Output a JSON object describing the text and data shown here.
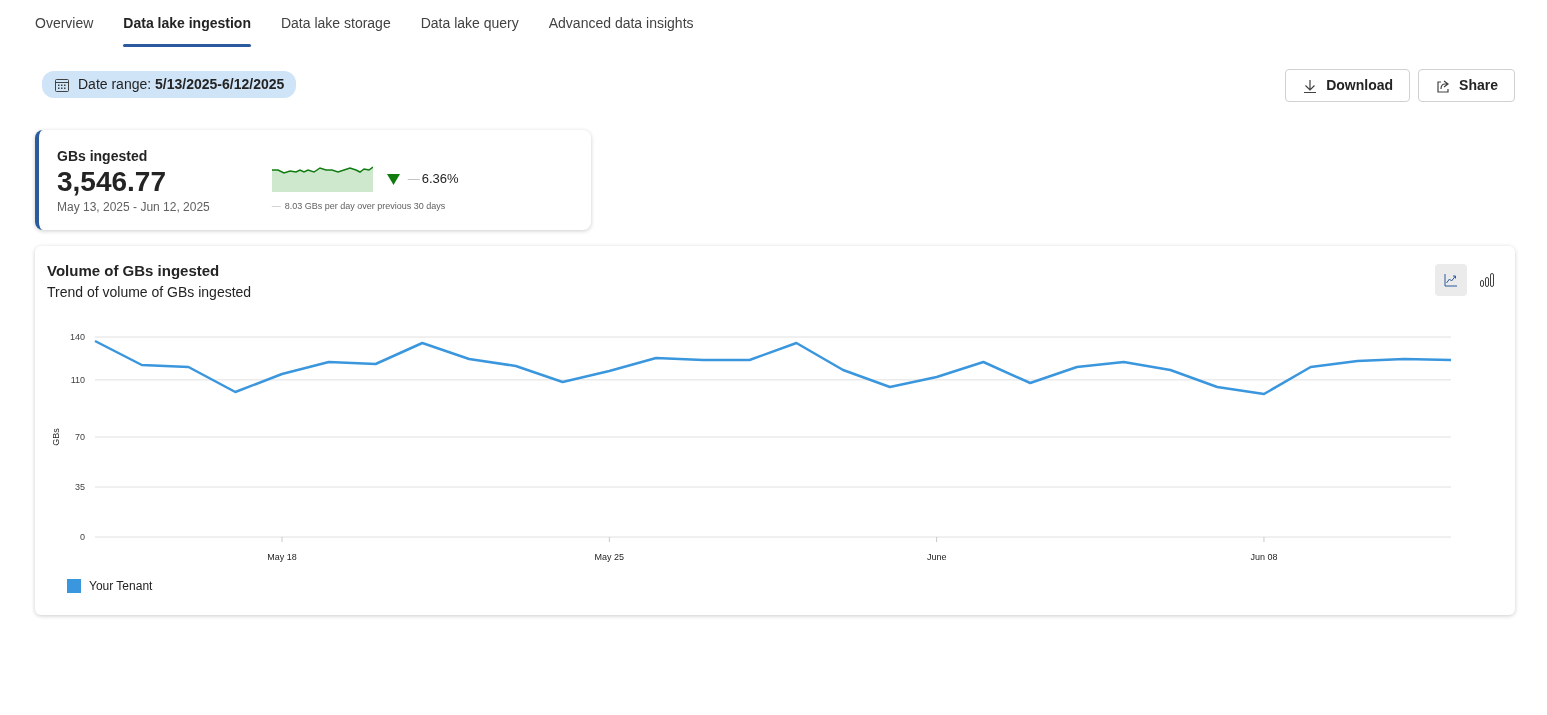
{
  "tabs": [
    {
      "label": "Overview",
      "selected": false
    },
    {
      "label": "Data lake ingestion",
      "selected": true
    },
    {
      "label": "Data lake storage",
      "selected": false
    },
    {
      "label": "Data lake query",
      "selected": false
    },
    {
      "label": "Advanced data insights",
      "selected": false
    }
  ],
  "date_range": {
    "label": "Date range:",
    "value": "5/13/2025-6/12/2025"
  },
  "actions": [
    {
      "kind": "download",
      "label": "Download"
    },
    {
      "kind": "share",
      "label": "Share"
    }
  ],
  "kpi": {
    "title": "GBs ingested",
    "value": "3,546.77",
    "period": "May 13, 2025 - Jun 12, 2025",
    "change_down": true,
    "change_prefix": "—",
    "change": "6.36%",
    "baseline_prefix": "—",
    "baseline": "8.03 GBs per day over previous 30 days"
  },
  "volume_chart": {
    "title": "Volume of GBs ingested",
    "subtitle": "Trend of volume of GBs ingested",
    "view_toggles": [
      {
        "kind": "line",
        "selected": true
      },
      {
        "kind": "bar",
        "selected": false
      }
    ],
    "chart_data": {
      "type": "line",
      "ylabel": "GBs",
      "ylim": [
        0,
        140
      ],
      "grid": true,
      "yticks": [
        0,
        35,
        70,
        110,
        140
      ],
      "categories": [
        null,
        null,
        null,
        null,
        "May 18",
        null,
        null,
        null,
        null,
        null,
        null,
        "May 25",
        null,
        null,
        null,
        null,
        null,
        null,
        "June",
        null,
        null,
        null,
        null,
        null,
        null,
        "Jun 08",
        null,
        null,
        null,
        null
      ],
      "series": [
        {
          "name": "Your Tenant",
          "color": "#3a96dd",
          "values": [
            137.2,
            120.4,
            119,
            101.5,
            114.1,
            122.5,
            121.1,
            135.8,
            124.6,
            119.7,
            108.5,
            116.2,
            125.3,
            123.9,
            123.9,
            135.8,
            116.9,
            105,
            112,
            122.5,
            107.8,
            119,
            122.5,
            116.9,
            105,
            100.1,
            119,
            123.2,
            124.6,
            123.9
          ]
        }
      ]
    }
  }
}
